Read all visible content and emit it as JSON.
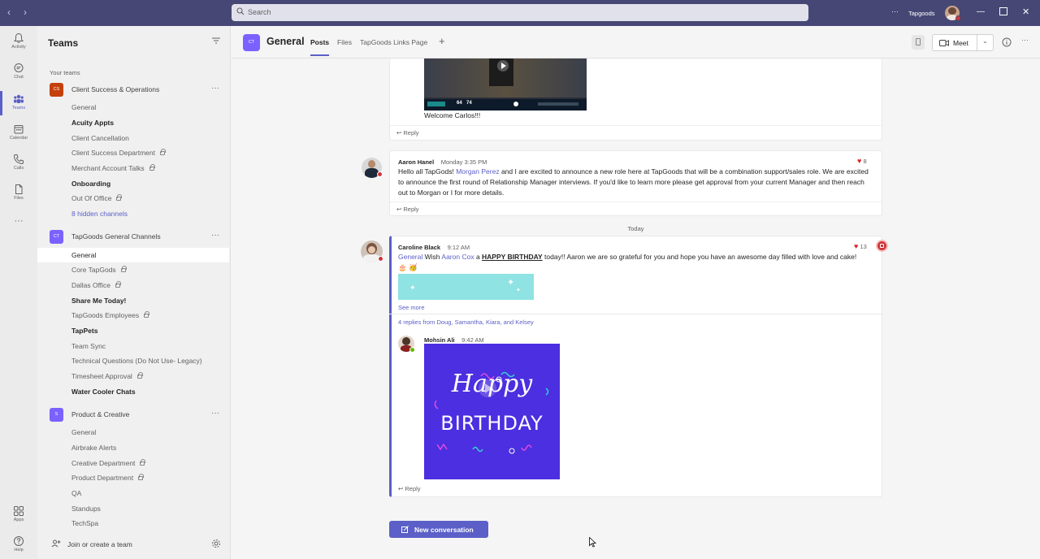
{
  "titlebar": {
    "search_placeholder": "Search",
    "more": "···",
    "org_name": "Tapgoods"
  },
  "rail": [
    {
      "label": "Activity",
      "icon": "bell-icon"
    },
    {
      "label": "Chat",
      "icon": "chat-icon"
    },
    {
      "label": "Teams",
      "icon": "teams-icon"
    },
    {
      "label": "Calendar",
      "icon": "calendar-icon"
    },
    {
      "label": "Calls",
      "icon": "phone-icon"
    },
    {
      "label": "Files",
      "icon": "file-icon"
    },
    {
      "label": "Apps",
      "icon": "apps-icon"
    },
    {
      "label": "Help",
      "icon": "help-icon"
    }
  ],
  "rail_more": "···",
  "left_panel": {
    "title": "Teams",
    "section": "Your teams",
    "teams": [
      {
        "initials": "CS",
        "name": "Client Success & Operations",
        "color": "#c4410c",
        "channels": [
          {
            "label": "General",
            "style": "normal",
            "locked": false
          },
          {
            "label": "Acuity Appts",
            "style": "bold",
            "locked": false
          },
          {
            "label": "Client Cancellation",
            "style": "normal",
            "locked": false
          },
          {
            "label": "Client Success Department",
            "style": "normal",
            "locked": true
          },
          {
            "label": "Merchant Account Talks",
            "style": "normal",
            "locked": true
          },
          {
            "label": "Onboarding",
            "style": "bold",
            "locked": false
          },
          {
            "label": "Out Of Office",
            "style": "normal",
            "locked": true
          },
          {
            "label": "8 hidden channels",
            "style": "link",
            "locked": false
          }
        ]
      },
      {
        "initials": "CT",
        "name": "TapGoods General Channels",
        "color": "#7b61ff",
        "channels": [
          {
            "label": "General",
            "style": "selected",
            "locked": false
          },
          {
            "label": "Core TapGods",
            "style": "normal",
            "locked": true
          },
          {
            "label": "Dallas Office",
            "style": "normal",
            "locked": true
          },
          {
            "label": "Share Me Today!",
            "style": "bold",
            "locked": false
          },
          {
            "label": "TapGoods Employees",
            "style": "normal",
            "locked": true
          },
          {
            "label": "TapPets",
            "style": "bold",
            "locked": false
          },
          {
            "label": "Team Sync",
            "style": "normal",
            "locked": false
          },
          {
            "label": "Technical Questions (Do Not Use- Legacy)",
            "style": "normal",
            "locked": false
          },
          {
            "label": "Timesheet Approval",
            "style": "normal",
            "locked": true
          },
          {
            "label": "Water Cooler Chats",
            "style": "bold",
            "locked": false
          }
        ]
      },
      {
        "initials": "S",
        "name": "Product & Creative",
        "color": "#7b61ff",
        "channels": [
          {
            "label": "General",
            "style": "normal",
            "locked": false
          },
          {
            "label": "Airbrake Alerts",
            "style": "normal",
            "locked": false
          },
          {
            "label": "Creative Department",
            "style": "normal",
            "locked": true
          },
          {
            "label": "Product Department",
            "style": "normal",
            "locked": true
          },
          {
            "label": "QA",
            "style": "normal",
            "locked": false
          },
          {
            "label": "Standups",
            "style": "normal",
            "locked": false
          },
          {
            "label": "TechSpa",
            "style": "normal",
            "locked": false
          }
        ]
      }
    ],
    "footer_label": "Join or create a team"
  },
  "channel": {
    "initials": "CT",
    "title": "General",
    "tabs": [
      "Posts",
      "Files",
      "TapGoods Links Page"
    ],
    "meet_label": "Meet"
  },
  "feed": {
    "video_scoreboard": {
      "home": "64",
      "away": "74"
    },
    "welcome_text": "Welcome Carlos!!!",
    "reply_label": "Reply",
    "post1": {
      "author": "Aaron Hanel",
      "time": "Monday 3:35 PM",
      "reactions": "8",
      "text_before": "Hello all TapGods! ",
      "mention": "Morgan Perez",
      "text_after": " and I are excited to announce a new role here at TapGoods that will be a combination support/sales role. We are excited to announce the first round of Relationship Manager interviews. If you'd like to learn more please get approval from your current Manager and then reach out to Morgan or I for more details."
    },
    "divider": "Today",
    "post2": {
      "author": "Caroline Black",
      "time": "9:12 AM",
      "reactions": "13",
      "mention1": "General",
      "text1": " Wish ",
      "mention2": "Aaron Cox",
      "text2": " a ",
      "highlight": "HAPPY BIRTHDAY",
      "text3": " today!! Aaron we are so grateful for you and hope you have an awesome day filled with love and cake! 🎂 🥳",
      "see_more": "See more",
      "replies_summary": "4 replies from Doug, Samantha, Kiara, and Kelsey"
    },
    "reply1": {
      "author": "Mohsin Ali",
      "time": "9:42 AM",
      "gif_line1": "Happy",
      "gif_line2": "BIRTHDAY"
    },
    "new_conversation": "New conversation"
  },
  "colors": {
    "titlebar": "#464775",
    "accent": "#5b5fc7",
    "gif_bg": "#4b2fe0",
    "banner": "#8fe3e3"
  }
}
